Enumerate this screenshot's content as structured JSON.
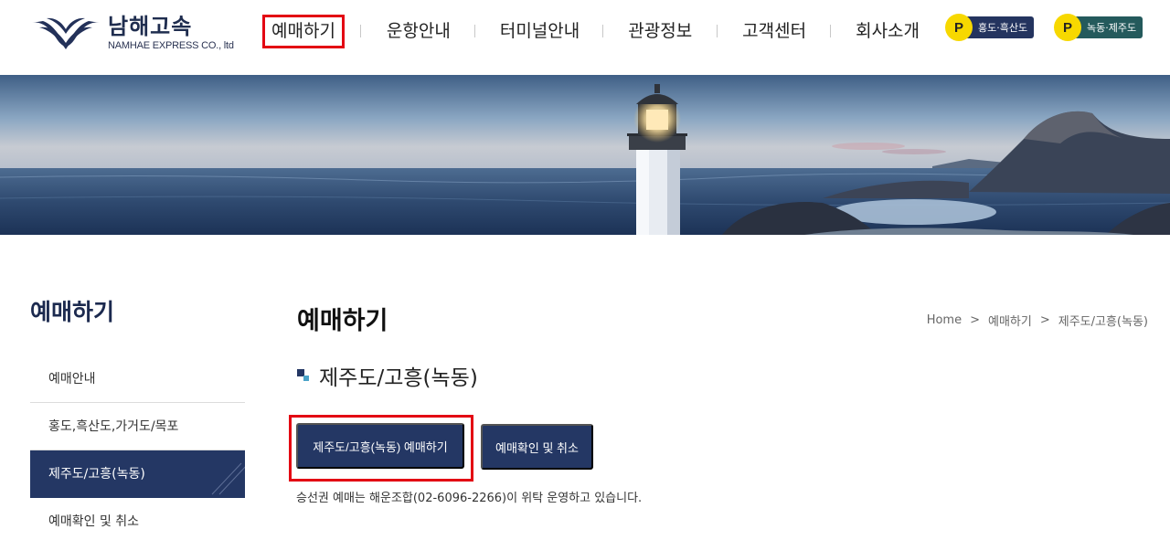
{
  "brand": {
    "name_ko": "남해고속",
    "name_en": "NAMHAE EXPRESS CO., ltd"
  },
  "gnb": {
    "items": [
      {
        "label": "예매하기"
      },
      {
        "label": "운항안내"
      },
      {
        "label": "터미널안내"
      },
      {
        "label": "관광정보"
      },
      {
        "label": "고객센터"
      },
      {
        "label": "회사소개"
      }
    ]
  },
  "quick_links": [
    {
      "badge": "P",
      "label": "홍도·흑산도",
      "color": "#24345f"
    },
    {
      "badge": "P",
      "label": "녹동·제주도",
      "color": "#245a5c"
    }
  ],
  "sidebar": {
    "title": "예매하기",
    "items": [
      {
        "label": "예매안내"
      },
      {
        "label": "홍도,흑산도,가거도/목포"
      },
      {
        "label": "제주도/고흥(녹동)"
      },
      {
        "label": "예매확인 및 취소"
      }
    ]
  },
  "content": {
    "page_title": "예매하기",
    "breadcrumb": [
      "Home",
      "예매하기",
      "제주도/고흥(녹동)"
    ],
    "breadcrumb_sep": ">",
    "section_title": "제주도/고흥(녹동)",
    "primary_button": "제주도/고흥(녹동) 예매하기",
    "secondary_button": "예매확인 및 취소",
    "notice": "승선권 예매는 해운조합(02-6096-2266)이 위탁 운영하고 있습니다."
  },
  "colors": {
    "navy": "#243764",
    "highlight_red": "#e30613",
    "badge_yellow": "#f7d800"
  }
}
